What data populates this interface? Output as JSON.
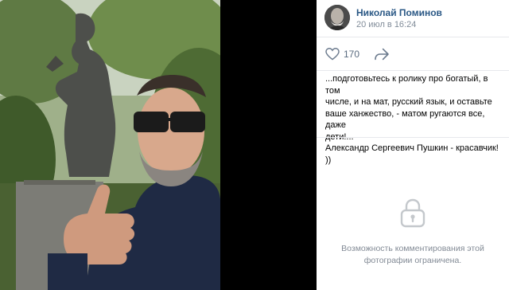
{
  "post": {
    "author": "Николай Поминов",
    "date": "20 июл в 16:24",
    "likes": "170",
    "caption_lines": [
      "...подготовьтесь к ролику про богатый, в том",
      "числе, и на мат, русский язык, и оставьте",
      "ваше ханжество, - матом ругаются все, даже",
      "дети!...",
      "Александр Сергеевич Пушкин - красавчик! ))"
    ]
  },
  "comments": {
    "restricted_line1": "Возможность комментирования этой",
    "restricted_line2": "фотографии ограничена."
  },
  "icons": {
    "like": "heart-icon",
    "share": "share-arrow-icon",
    "lock": "lock-icon"
  },
  "colors": {
    "author_link": "#2a5885",
    "secondary_text": "#818c99",
    "lock_gray": "#c4c8cc"
  }
}
